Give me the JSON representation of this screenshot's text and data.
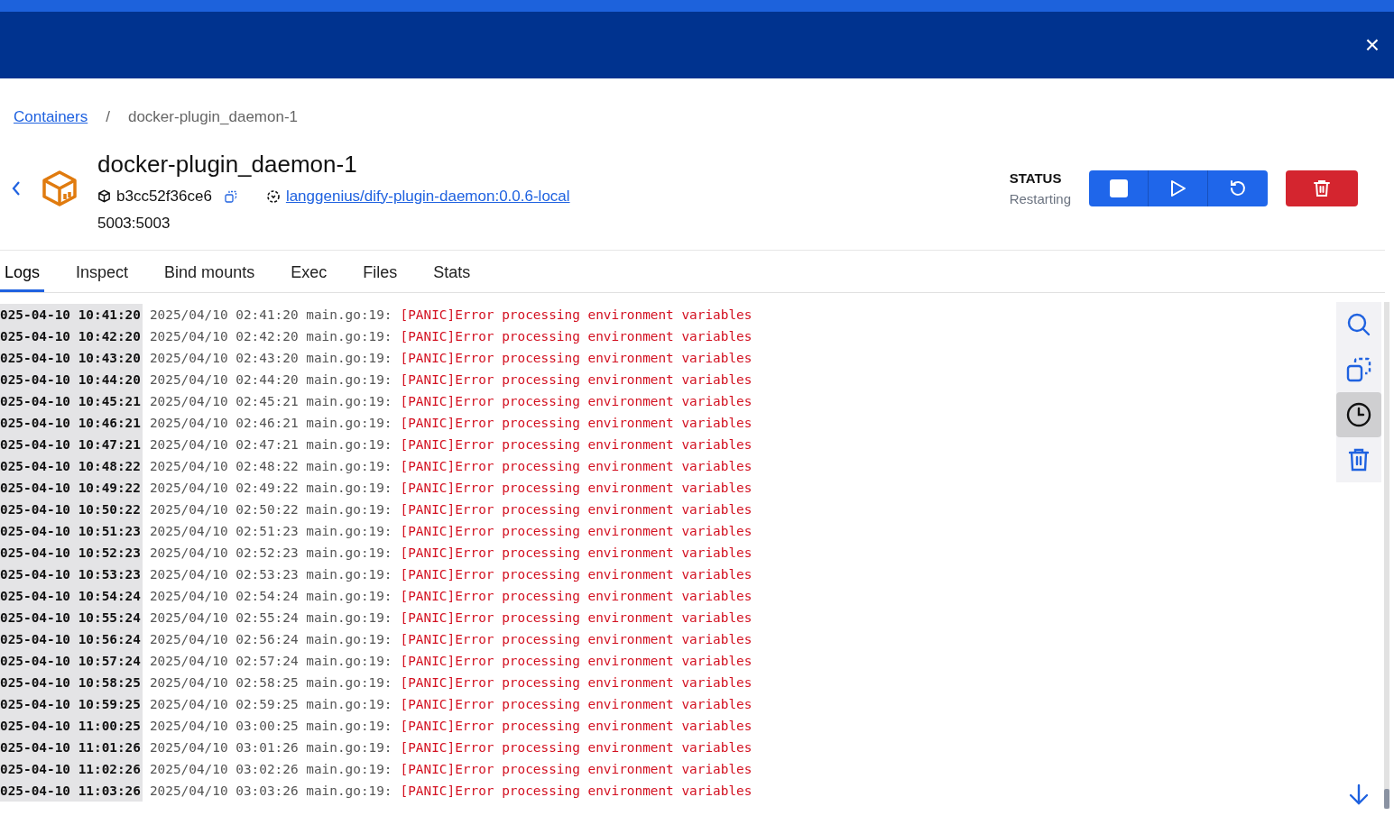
{
  "close_button": "×",
  "breadcrumb": {
    "link": "Containers",
    "separator": "/",
    "current": "docker-plugin_daemon-1"
  },
  "container": {
    "name": "docker-plugin_daemon-1",
    "id": "b3cc52f36ce6",
    "image": "langgenius/dify-plugin-daemon:0.0.6-local",
    "ports": "5003:5003"
  },
  "status": {
    "label": "STATUS",
    "value": "Restarting"
  },
  "actions": [
    {
      "kind": "stop"
    },
    {
      "kind": "start"
    },
    {
      "kind": "restart"
    }
  ],
  "tabs": [
    {
      "label": "Logs",
      "selected": true
    },
    {
      "label": "Inspect",
      "selected": false
    },
    {
      "label": "Bind mounts",
      "selected": false
    },
    {
      "label": "Exec",
      "selected": false
    },
    {
      "label": "Files",
      "selected": false
    },
    {
      "label": "Stats",
      "selected": false
    }
  ],
  "log_tools": [
    {
      "kind": "search",
      "selected": false
    },
    {
      "kind": "copy",
      "selected": false
    },
    {
      "kind": "timestamps",
      "selected": true
    },
    {
      "kind": "clear",
      "selected": false
    }
  ],
  "logs": [
    {
      "timestamp": "025-04-10 10:41:20",
      "prefix": "2025/04/10 02:41:20 main.go:19:",
      "message": "[PANIC]Error processing environment variables"
    },
    {
      "timestamp": "025-04-10 10:42:20",
      "prefix": "2025/04/10 02:42:20 main.go:19:",
      "message": "[PANIC]Error processing environment variables"
    },
    {
      "timestamp": "025-04-10 10:43:20",
      "prefix": "2025/04/10 02:43:20 main.go:19:",
      "message": "[PANIC]Error processing environment variables"
    },
    {
      "timestamp": "025-04-10 10:44:20",
      "prefix": "2025/04/10 02:44:20 main.go:19:",
      "message": "[PANIC]Error processing environment variables"
    },
    {
      "timestamp": "025-04-10 10:45:21",
      "prefix": "2025/04/10 02:45:21 main.go:19:",
      "message": "[PANIC]Error processing environment variables"
    },
    {
      "timestamp": "025-04-10 10:46:21",
      "prefix": "2025/04/10 02:46:21 main.go:19:",
      "message": "[PANIC]Error processing environment variables"
    },
    {
      "timestamp": "025-04-10 10:47:21",
      "prefix": "2025/04/10 02:47:21 main.go:19:",
      "message": "[PANIC]Error processing environment variables"
    },
    {
      "timestamp": "025-04-10 10:48:22",
      "prefix": "2025/04/10 02:48:22 main.go:19:",
      "message": "[PANIC]Error processing environment variables"
    },
    {
      "timestamp": "025-04-10 10:49:22",
      "prefix": "2025/04/10 02:49:22 main.go:19:",
      "message": "[PANIC]Error processing environment variables"
    },
    {
      "timestamp": "025-04-10 10:50:22",
      "prefix": "2025/04/10 02:50:22 main.go:19:",
      "message": "[PANIC]Error processing environment variables"
    },
    {
      "timestamp": "025-04-10 10:51:23",
      "prefix": "2025/04/10 02:51:23 main.go:19:",
      "message": "[PANIC]Error processing environment variables"
    },
    {
      "timestamp": "025-04-10 10:52:23",
      "prefix": "2025/04/10 02:52:23 main.go:19:",
      "message": "[PANIC]Error processing environment variables"
    },
    {
      "timestamp": "025-04-10 10:53:23",
      "prefix": "2025/04/10 02:53:23 main.go:19:",
      "message": "[PANIC]Error processing environment variables"
    },
    {
      "timestamp": "025-04-10 10:54:24",
      "prefix": "2025/04/10 02:54:24 main.go:19:",
      "message": "[PANIC]Error processing environment variables"
    },
    {
      "timestamp": "025-04-10 10:55:24",
      "prefix": "2025/04/10 02:55:24 main.go:19:",
      "message": "[PANIC]Error processing environment variables"
    },
    {
      "timestamp": "025-04-10 10:56:24",
      "prefix": "2025/04/10 02:56:24 main.go:19:",
      "message": "[PANIC]Error processing environment variables"
    },
    {
      "timestamp": "025-04-10 10:57:24",
      "prefix": "2025/04/10 02:57:24 main.go:19:",
      "message": "[PANIC]Error processing environment variables"
    },
    {
      "timestamp": "025-04-10 10:58:25",
      "prefix": "2025/04/10 02:58:25 main.go:19:",
      "message": "[PANIC]Error processing environment variables"
    },
    {
      "timestamp": "025-04-10 10:59:25",
      "prefix": "2025/04/10 02:59:25 main.go:19:",
      "message": "[PANIC]Error processing environment variables"
    },
    {
      "timestamp": "025-04-10 11:00:25",
      "prefix": "2025/04/10 03:00:25 main.go:19:",
      "message": "[PANIC]Error processing environment variables"
    },
    {
      "timestamp": "025-04-10 11:01:26",
      "prefix": "2025/04/10 03:01:26 main.go:19:",
      "message": "[PANIC]Error processing environment variables"
    },
    {
      "timestamp": "025-04-10 11:02:26",
      "prefix": "2025/04/10 03:02:26 main.go:19:",
      "message": "[PANIC]Error processing environment variables"
    },
    {
      "timestamp": "025-04-10 11:03:26",
      "prefix": "2025/04/10 03:03:26 main.go:19:",
      "message": "[PANIC]Error processing environment variables"
    }
  ]
}
